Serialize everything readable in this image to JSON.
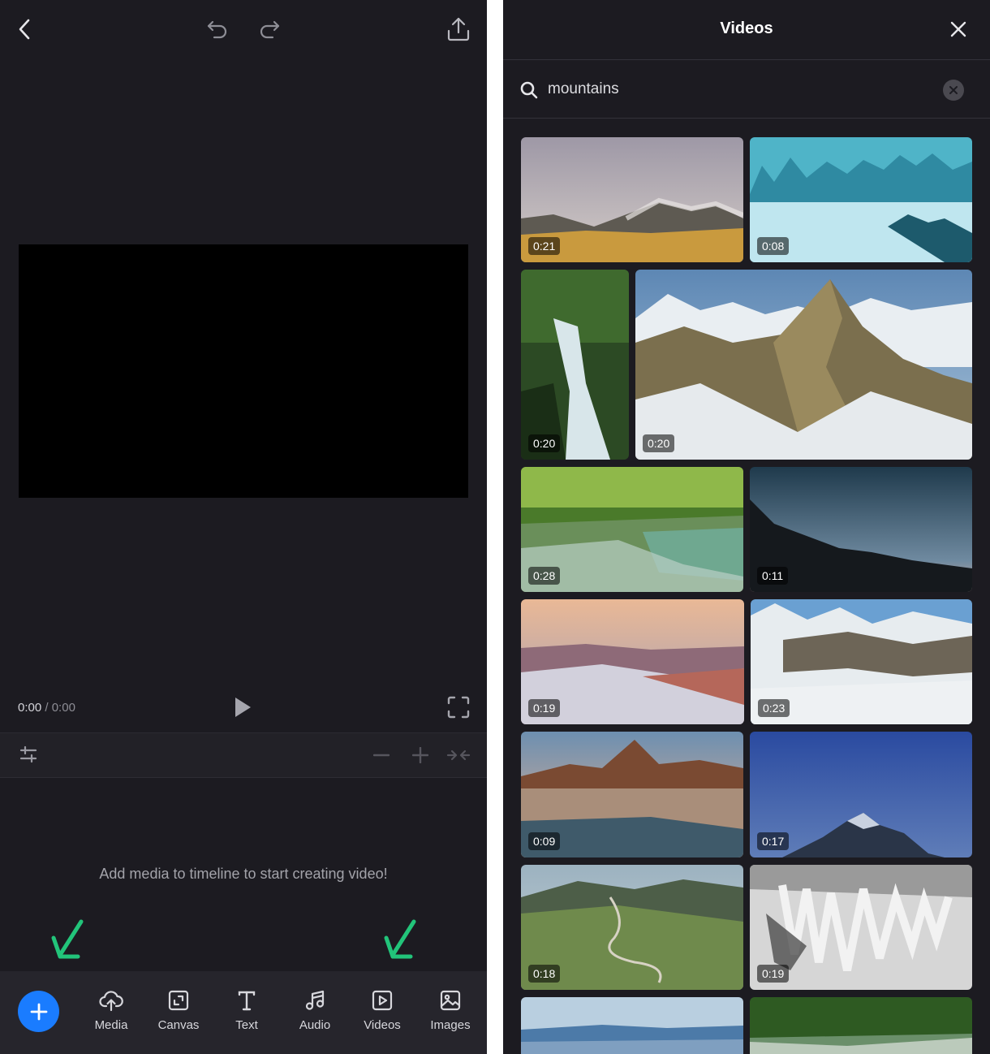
{
  "editor": {
    "timecode_current": "0:00",
    "timecode_separator": " / ",
    "timecode_total": "0:00",
    "empty_hint": "Add media to timeline to start creating video!"
  },
  "toolbar": {
    "items": [
      {
        "label": "Media",
        "icon": "cloud-upload-icon"
      },
      {
        "label": "Canvas",
        "icon": "canvas-resize-icon"
      },
      {
        "label": "Text",
        "icon": "text-icon"
      },
      {
        "label": "Audio",
        "icon": "music-note-icon"
      },
      {
        "label": "Videos",
        "icon": "video-play-icon"
      },
      {
        "label": "Images",
        "icon": "image-icon"
      }
    ]
  },
  "annotations": {
    "arrow_color": "#22c47a"
  },
  "videos_panel": {
    "title": "Videos",
    "search_value": "mountains",
    "results": [
      {
        "duration": "0:21"
      },
      {
        "duration": "0:08"
      },
      {
        "duration": "0:20"
      },
      {
        "duration": "0:20"
      },
      {
        "duration": "0:28"
      },
      {
        "duration": "0:11"
      },
      {
        "duration": "0:19"
      },
      {
        "duration": "0:23"
      },
      {
        "duration": "0:09"
      },
      {
        "duration": "0:17"
      },
      {
        "duration": "0:18"
      },
      {
        "duration": "0:19"
      },
      {
        "duration": ""
      },
      {
        "duration": ""
      }
    ]
  },
  "colors": {
    "accent": "#1a7cff",
    "background": "#1c1b21",
    "toolbar": "#26252c"
  }
}
